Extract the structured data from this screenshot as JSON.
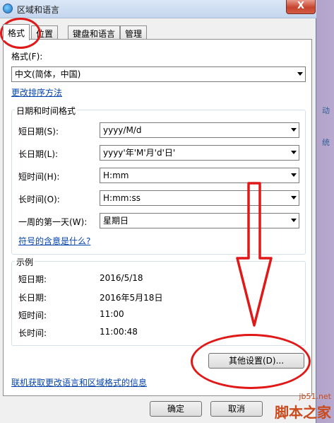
{
  "window": {
    "title": "区域和语言",
    "close": "X"
  },
  "tabs": [
    {
      "label": "格式"
    },
    {
      "label": "位置"
    },
    {
      "label": "键盘和语言"
    },
    {
      "label": "管理"
    }
  ],
  "format": {
    "label": "格式(F):",
    "value": "中文(简体，中国)",
    "sort_link": "更改排序方法"
  },
  "datetime_group": {
    "title": "日期和时间格式",
    "rows": [
      {
        "label": "短日期(S):",
        "value": "yyyy/M/d"
      },
      {
        "label": "长日期(L):",
        "value": "yyyy'年'M'月'd'日'"
      },
      {
        "label": "短时间(H):",
        "value": "H:mm"
      },
      {
        "label": "长时间(O):",
        "value": "H:mm:ss"
      },
      {
        "label": "一周的第一天(W):",
        "value": "星期日"
      }
    ],
    "symbol_link": "符号的含意是什么?"
  },
  "example_group": {
    "title": "示例",
    "rows": [
      {
        "label": "短日期:",
        "value": "2016/5/18"
      },
      {
        "label": "长日期:",
        "value": "2016年5月18日"
      },
      {
        "label": "短时间:",
        "value": "11:00"
      },
      {
        "label": "长时间:",
        "value": "11:00:48"
      }
    ]
  },
  "buttons": {
    "other_settings": "其他设置(D)...",
    "ok": "确定",
    "cancel": "取消"
  },
  "online_link": "联机获取更改语言和区域格式的信息",
  "background": {
    "side_text_1": "动",
    "side_text_2": "统"
  },
  "watermark": {
    "site": "jb51.net",
    "name": "脚本之家"
  },
  "colors": {
    "annotation": "#e01818",
    "link": "#0645ad",
    "title_bar": "#c4d6ee"
  }
}
